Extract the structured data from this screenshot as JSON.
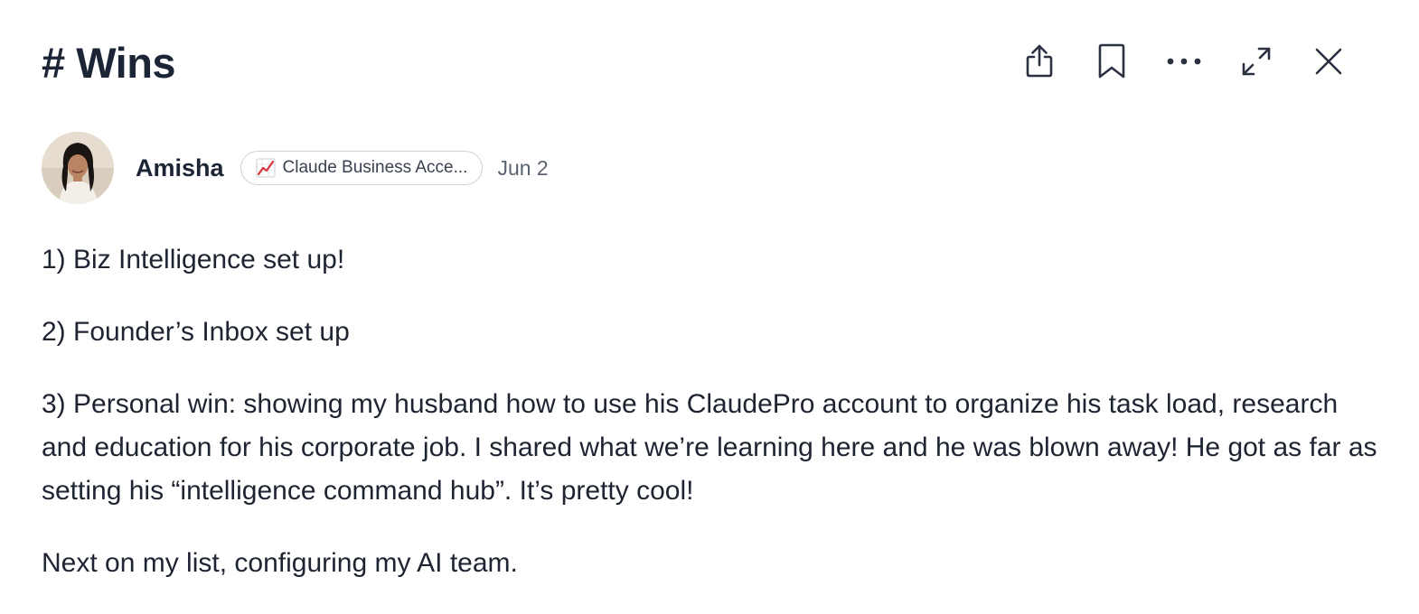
{
  "channel": {
    "title": "# Wins"
  },
  "toolbar": {
    "share_icon": "share-icon",
    "bookmark_icon": "bookmark-icon",
    "more_icon": "more-horizontal-icon",
    "expand_icon": "expand-icon",
    "close_icon": "close-icon"
  },
  "post": {
    "author": "Amisha",
    "badge": {
      "icon": "chart-increasing-emoji",
      "label": "Claude Business Acce..."
    },
    "date": "Jun 2",
    "paragraphs": [
      "1) Biz Intelligence set up!",
      "2) Founder’s Inbox set up",
      "3) Personal win: showing my husband how to use his ClaudePro account to organize his task load, research and education for his corporate job. I shared what we’re learning here and he was blown away! He got as far as setting his “intelligence command hub”. It’s pretty cool!",
      "Next on my list, configuring my AI team."
    ]
  },
  "colors": {
    "title": "#1c2536",
    "text": "#1f2433",
    "muted": "#5c6370",
    "badge_border": "#cdd1d9",
    "icon": "#2b3140"
  }
}
